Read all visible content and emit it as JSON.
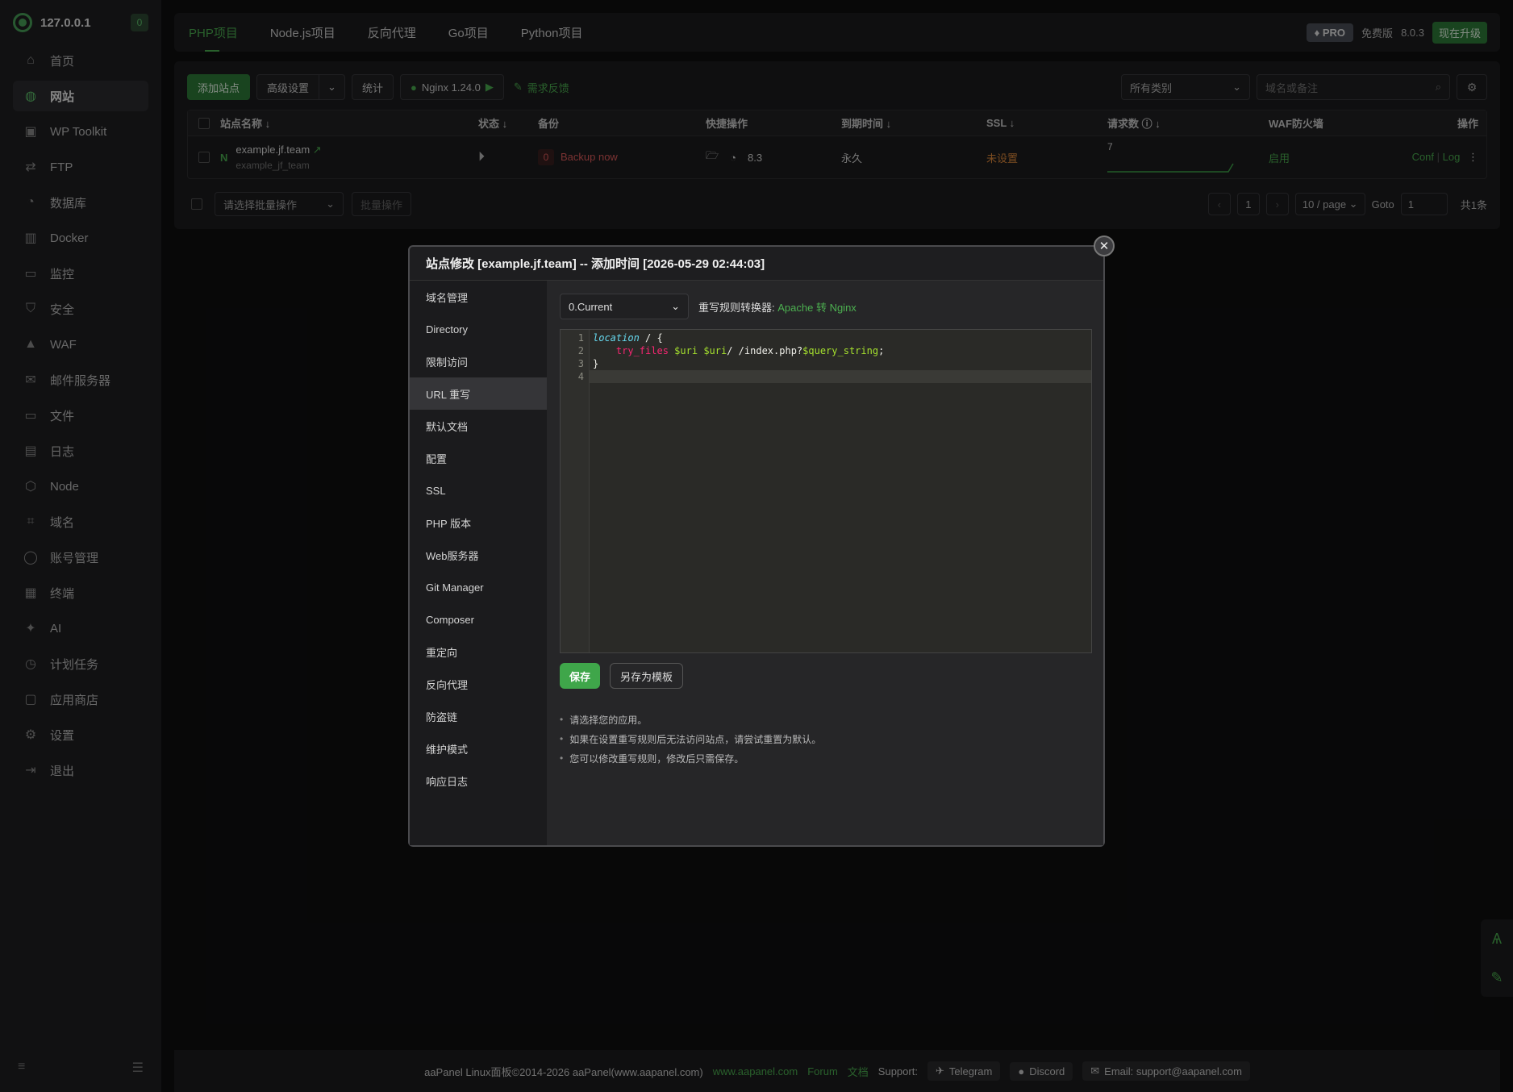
{
  "sidebar": {
    "server_ip": "127.0.0.1",
    "badge_count": "0",
    "items": [
      {
        "label": "首页",
        "icon": "home-icon"
      },
      {
        "label": "网站",
        "icon": "globe-icon",
        "active": true
      },
      {
        "label": "WP Toolkit",
        "icon": "wp-icon"
      },
      {
        "label": "FTP",
        "icon": "ftp-icon"
      },
      {
        "label": "数据库",
        "icon": "database-icon"
      },
      {
        "label": "Docker",
        "icon": "docker-icon"
      },
      {
        "label": "监控",
        "icon": "monitor-icon"
      },
      {
        "label": "安全",
        "icon": "shield-icon"
      },
      {
        "label": "WAF",
        "icon": "waf-icon"
      },
      {
        "label": "邮件服务器",
        "icon": "mail-icon"
      },
      {
        "label": "文件",
        "icon": "folder-icon"
      },
      {
        "label": "日志",
        "icon": "log-icon"
      },
      {
        "label": "Node",
        "icon": "node-icon"
      },
      {
        "label": "域名",
        "icon": "domain-icon"
      },
      {
        "label": "账号管理",
        "icon": "user-icon"
      },
      {
        "label": "终端",
        "icon": "terminal-icon"
      },
      {
        "label": "AI",
        "icon": "ai-icon"
      },
      {
        "label": "计划任务",
        "icon": "clock-icon"
      },
      {
        "label": "应用商店",
        "icon": "store-icon"
      },
      {
        "label": "设置",
        "icon": "gear-icon"
      },
      {
        "label": "退出",
        "icon": "logout-icon"
      }
    ]
  },
  "topbar": {
    "tabs": [
      "PHP项目",
      "Node.js项目",
      "反向代理",
      "Go项目",
      "Python项目"
    ],
    "active_tab": "PHP项目",
    "pro_label": "PRO",
    "edition": "免费版",
    "version": "8.0.3",
    "upgrade_label": "现在升级"
  },
  "toolbar": {
    "add_site": "添加站点",
    "advanced": "高级设置",
    "stats": "统计",
    "nginx": "Nginx 1.24.0",
    "feedback": "需求反馈",
    "category": "所有类别",
    "search_placeholder": "域名或备注"
  },
  "table": {
    "headers": {
      "name": "站点名称",
      "status": "状态",
      "backup": "备份",
      "quick": "快捷操作",
      "expire": "到期时间",
      "ssl": "SSL",
      "requests": "请求数",
      "waf": "WAF防火墙",
      "ops": "操作"
    },
    "rows": [
      {
        "name": "example.jf.team",
        "remark": "example_jf_team",
        "backup_count": "0",
        "backup_label": "Backup now",
        "php": "8.3",
        "expire": "永久",
        "ssl": "未设置",
        "requests": "7",
        "waf": "启用",
        "conf": "Conf",
        "log": "Log"
      }
    ]
  },
  "batch": {
    "select_placeholder": "请选择批量操作",
    "button": "批量操作"
  },
  "pager": {
    "page": "1",
    "per_page": "10 / page",
    "goto_label": "Goto",
    "goto_value": "1",
    "total": "共1条"
  },
  "modal": {
    "title": "站点修改 [example.jf.team] -- 添加时间 [2026-05-29 02:44:03]",
    "nav": [
      "域名管理",
      "Directory",
      "限制访问",
      "URL 重写",
      "默认文档",
      "配置",
      "SSL",
      "PHP 版本",
      "Web服务器",
      "Git Manager",
      "Composer",
      "重定向",
      "反向代理",
      "防盗链",
      "维护模式",
      "响应日志"
    ],
    "active_nav": "URL 重写",
    "version_select": "0.Current",
    "converter_label": "重写规则转换器:",
    "converter_link": "Apache 转 Nginx",
    "code_lines": [
      "1",
      "2",
      "3",
      "4"
    ],
    "save": "保存",
    "save_template": "另存为模板",
    "tips": [
      "请选择您的应用。",
      "如果在设置重写规则后无法访问站点，请尝试重置为默认。",
      "您可以修改重写规则，修改后只需保存。"
    ]
  },
  "footer": {
    "copyright": "aaPanel Linux面板©2014-2026 aaPanel(www.aapanel.com)",
    "site_link": "www.aapanel.com",
    "forum": "Forum",
    "docs": "文档",
    "support": "Support:",
    "telegram": "Telegram",
    "discord": "Discord",
    "email": "Email: support@aapanel.com"
  },
  "colors": {
    "accent": "#4caf50",
    "danger": "#e05c5c",
    "warning": "#e08a3c"
  }
}
